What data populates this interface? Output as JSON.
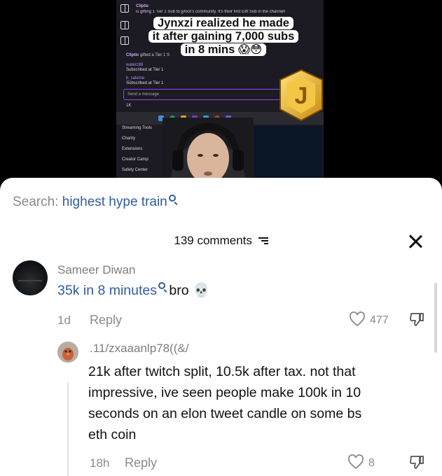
{
  "video": {
    "chat": {
      "gift1_user": "Cliptic",
      "gift1_text": "is gifting 1 Tier 1 Sub to jynxzi's community. It's their first Gift Sub in the channel!",
      "gift2_user": "Cliptic",
      "gift2_text": "gifted a Tier 1 S",
      "sub1_user": "waterz88",
      "sub1_text": "Subscribed at Tier 1",
      "sub2_user": "b_saleme",
      "sub2_text": "Subscribed at Tier 1",
      "send_placeholder": "Send a message",
      "viewer_count": "1K"
    },
    "menu": [
      "Streaming Tools",
      "Charity",
      "Extensions",
      "Creator Camp",
      "Safety Center"
    ],
    "caption_emoji": "😱😳",
    "caption": [
      "Jynxzi realized he made",
      "it after gaining 7,000 subs",
      "in 8 mins"
    ]
  },
  "sheet": {
    "search_prefix": "Search:",
    "search_query": "highest hype train",
    "comment_count": "139 comments",
    "comments": [
      {
        "username": "Sameer Diwan",
        "text_link": "35k in 8 minutes",
        "text_rest": "bro 💀",
        "time": "1d",
        "reply_label": "Reply",
        "likes": "477"
      },
      {
        "username": ".11/zxaaanlp78((&/",
        "text_lines": [
          "21k after twitch split, 10.5k after tax. not that",
          "impressive, ive seen people make 100k in 10",
          "seconds on an elon tweet candle on some bs",
          "eth coin"
        ],
        "time": "18h",
        "reply_label": "Reply",
        "likes": "8"
      }
    ]
  },
  "colors": {
    "link": "#2f5c9c",
    "muted": "#8a8a8f",
    "twitch_purple": "#9147ff"
  }
}
